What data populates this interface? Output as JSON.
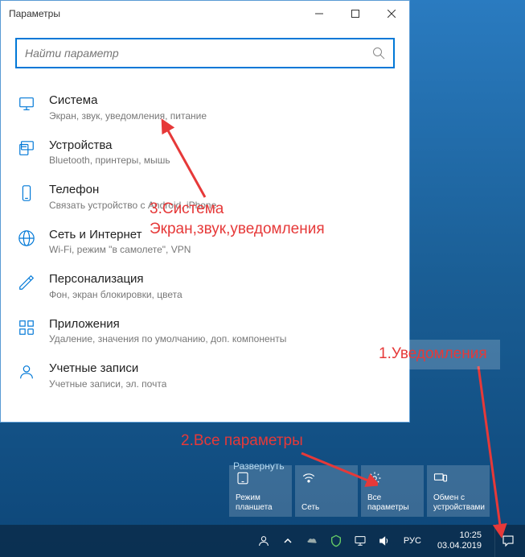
{
  "window": {
    "title": "Параметры"
  },
  "search": {
    "placeholder": "Найти параметр"
  },
  "items": [
    {
      "name": "system",
      "title": "Система",
      "desc": "Экран, звук, уведомления, питание"
    },
    {
      "name": "devices",
      "title": "Устройства",
      "desc": "Bluetooth, принтеры, мышь"
    },
    {
      "name": "phone",
      "title": "Телефон",
      "desc": "Связать устройство с Android, iPhone"
    },
    {
      "name": "network",
      "title": "Сеть и Интернет",
      "desc": "Wi-Fi, режим \"в самолете\", VPN"
    },
    {
      "name": "personalization",
      "title": "Персонализация",
      "desc": "Фон, экран блокировки, цвета"
    },
    {
      "name": "apps",
      "title": "Приложения",
      "desc": "Удаление, значения по умолчанию, доп. компоненты"
    },
    {
      "name": "accounts",
      "title": "Учетные записи",
      "desc": "Учетные записи, эл. почта"
    }
  ],
  "ac": {
    "expand": "Развернуть",
    "tiles": [
      {
        "name": "tablet",
        "label": "Режим планшета"
      },
      {
        "name": "network",
        "label": "Сеть"
      },
      {
        "name": "all-settings",
        "label": "Все параметры"
      },
      {
        "name": "connect",
        "label": "Обмен с устройствами"
      }
    ]
  },
  "tray": {
    "lang": "РУС",
    "time": "10:25",
    "date": "03.04.2019"
  },
  "annotations": {
    "a1": "1.Уведомления",
    "a2": "2.Все параметры",
    "a3_l1": "3.Система",
    "a3_l2": "Экран,звук,уведомления"
  }
}
